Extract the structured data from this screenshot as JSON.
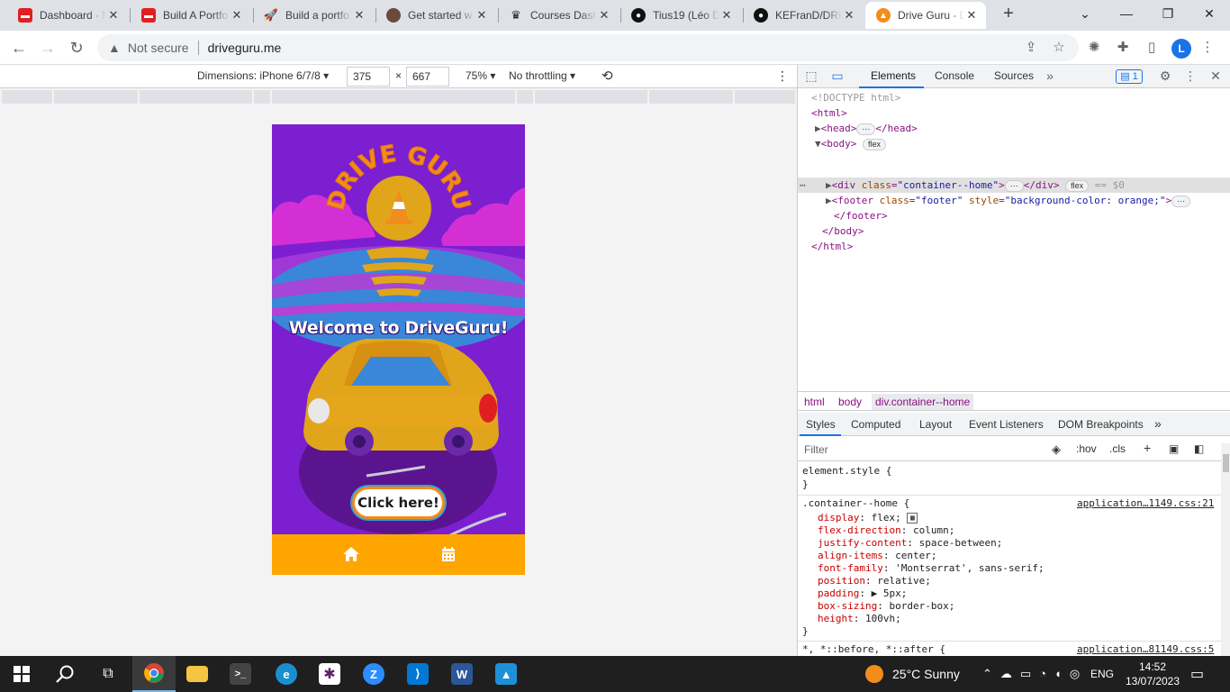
{
  "browser": {
    "tabs": [
      {
        "title": "Dashboard · M",
        "icon": "le-wagon-icon",
        "color": "#e02020",
        "active": false
      },
      {
        "title": "Build A Portfo",
        "icon": "le-wagon-icon",
        "color": "#e02020",
        "active": false
      },
      {
        "title": "Build a portfo",
        "icon": "rocket-icon",
        "color": "#d86b1d",
        "active": false
      },
      {
        "title": "Get started w",
        "icon": "avatar-icon",
        "color": "#6b4a3a",
        "active": false
      },
      {
        "title": "Courses Dash",
        "icon": "crown-icon",
        "color": "#222222",
        "active": false
      },
      {
        "title": "Tius19 (Léo D",
        "icon": "github-icon",
        "color": "#111111",
        "active": false
      },
      {
        "title": "KEFranD/DRIV",
        "icon": "github-icon",
        "color": "#111111",
        "active": false
      },
      {
        "title": "Drive Guru - D",
        "icon": "drive-guru-icon",
        "color": "#f28c1b",
        "active": true
      }
    ],
    "new_tab_label": "+",
    "security_label": "Not secure",
    "url": "driveguru.me",
    "profile_initial": "L"
  },
  "device_toolbar": {
    "dimensions_label": "Dimensions: iPhone 6/7/8",
    "width": "375",
    "height": "667",
    "times": "×",
    "zoom": "75%",
    "throttling": "No throttling"
  },
  "page": {
    "logo_text": "DRIVE GURU",
    "welcome": "Welcome to DriveGuru!",
    "cta_label": "Click here!",
    "footer_color": "#ffa500",
    "background_color": "#7b1fd0"
  },
  "devtools": {
    "tabs": [
      "Elements",
      "Console",
      "Sources"
    ],
    "active_tab": "Elements",
    "issues_count": "1",
    "dom": {
      "doctype": "<!DOCTYPE html>",
      "html_open": "<html>",
      "head_open": "<head>",
      "head_close": "</head>",
      "body_open": "<body>",
      "div_tag": "div",
      "div_attr": "class",
      "div_val": "\"container--home\"",
      "div_close": "</div>",
      "selected_marker": "== $0",
      "footer_tag": "footer",
      "footer_attr1": "class",
      "footer_val1": "\"footer\"",
      "footer_attr2": "style",
      "footer_val2": "\"background-color: orange;\"",
      "footer_close": "</footer>",
      "body_close": "</body>",
      "html_close": "</html>",
      "flex_badge": "flex"
    },
    "breadcrumbs": [
      "html",
      "body",
      "div.container--home"
    ],
    "style_tabs": [
      "Styles",
      "Computed",
      "Layout",
      "Event Listeners",
      "DOM Breakpoints"
    ],
    "filter_placeholder": "Filter",
    "filter_tools": [
      ":hov",
      ".cls"
    ],
    "element_style": "element.style {",
    "rule_selector": ".container--home {",
    "rule_source": "application…1149.css:21",
    "declarations": [
      {
        "prop": "display",
        "value": "flex;"
      },
      {
        "prop": "flex-direction",
        "value": "column;"
      },
      {
        "prop": "justify-content",
        "value": "space-between;"
      },
      {
        "prop": "align-items",
        "value": "center;"
      },
      {
        "prop": "font-family",
        "value": "'Montserrat', sans-serif;"
      },
      {
        "prop": "position",
        "value": "relative;"
      },
      {
        "prop": "padding",
        "value": "▶ 5px;"
      },
      {
        "prop": "box-sizing",
        "value": "border-box;"
      },
      {
        "prop": "height",
        "value": "100vh;"
      }
    ],
    "next_selector": "*, *::before, *::after {",
    "next_source": "application…81149.css:5"
  },
  "taskbar": {
    "weather": "25°C  Sunny",
    "language": "ENG",
    "time": "14:52",
    "date": "13/07/2023"
  }
}
